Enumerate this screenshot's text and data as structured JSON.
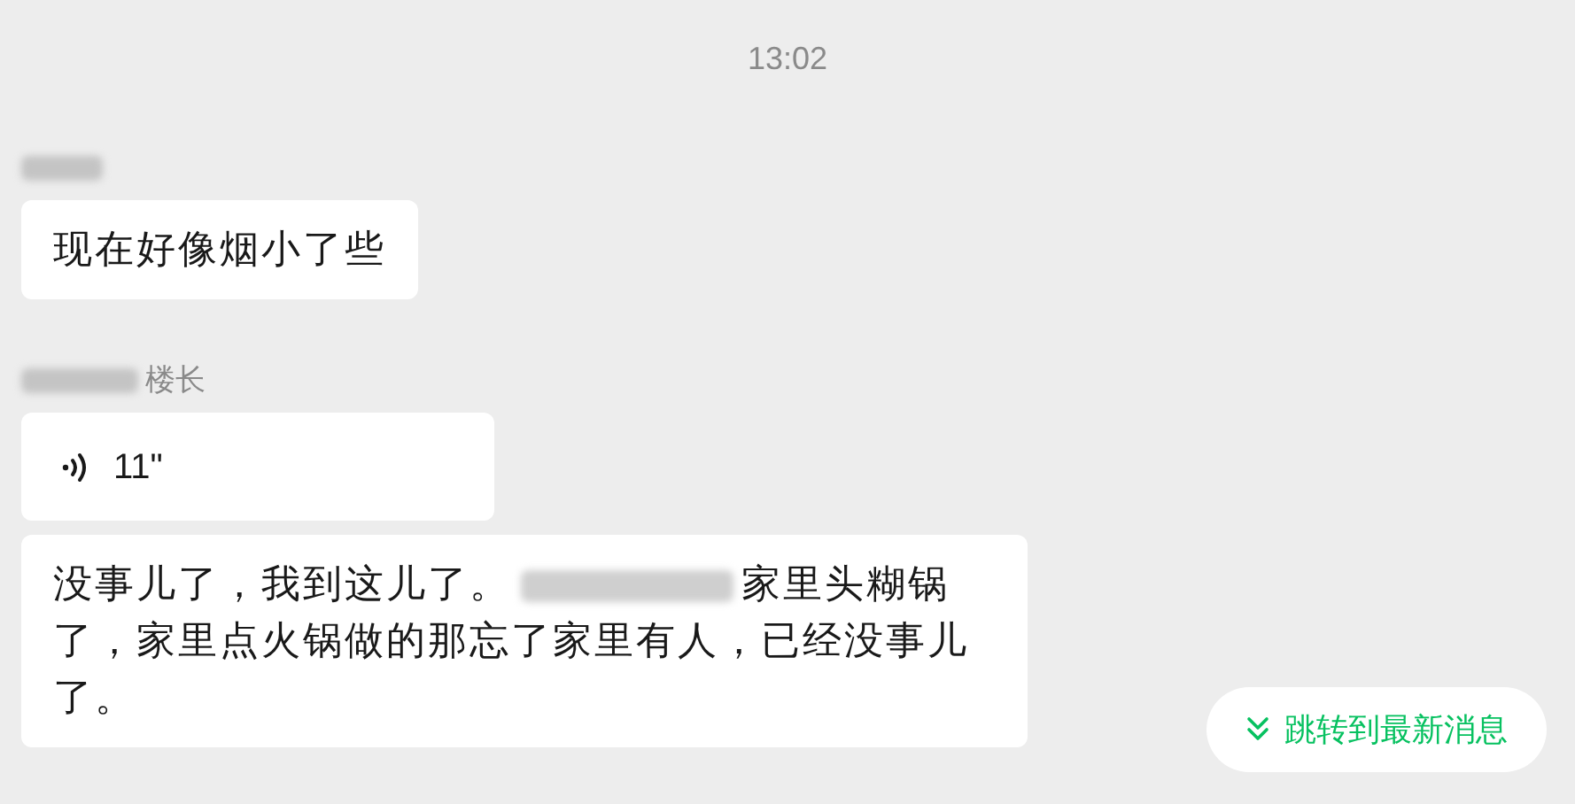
{
  "time": "13:02",
  "groups": [
    {
      "messages": [
        {
          "kind": "text",
          "parts": [
            "现在好像烟小了些"
          ]
        }
      ]
    },
    {
      "sender_title": "楼长",
      "messages": [
        {
          "kind": "voice",
          "duration": "11\""
        },
        {
          "kind": "text",
          "parts": [
            "没事儿了，我到这儿了。",
            "家里头糊锅了，家里点火锅做的那忘了家里有人，已经没事儿了。"
          ]
        }
      ]
    }
  ],
  "jump_button": {
    "label": "跳转到最新消息"
  }
}
